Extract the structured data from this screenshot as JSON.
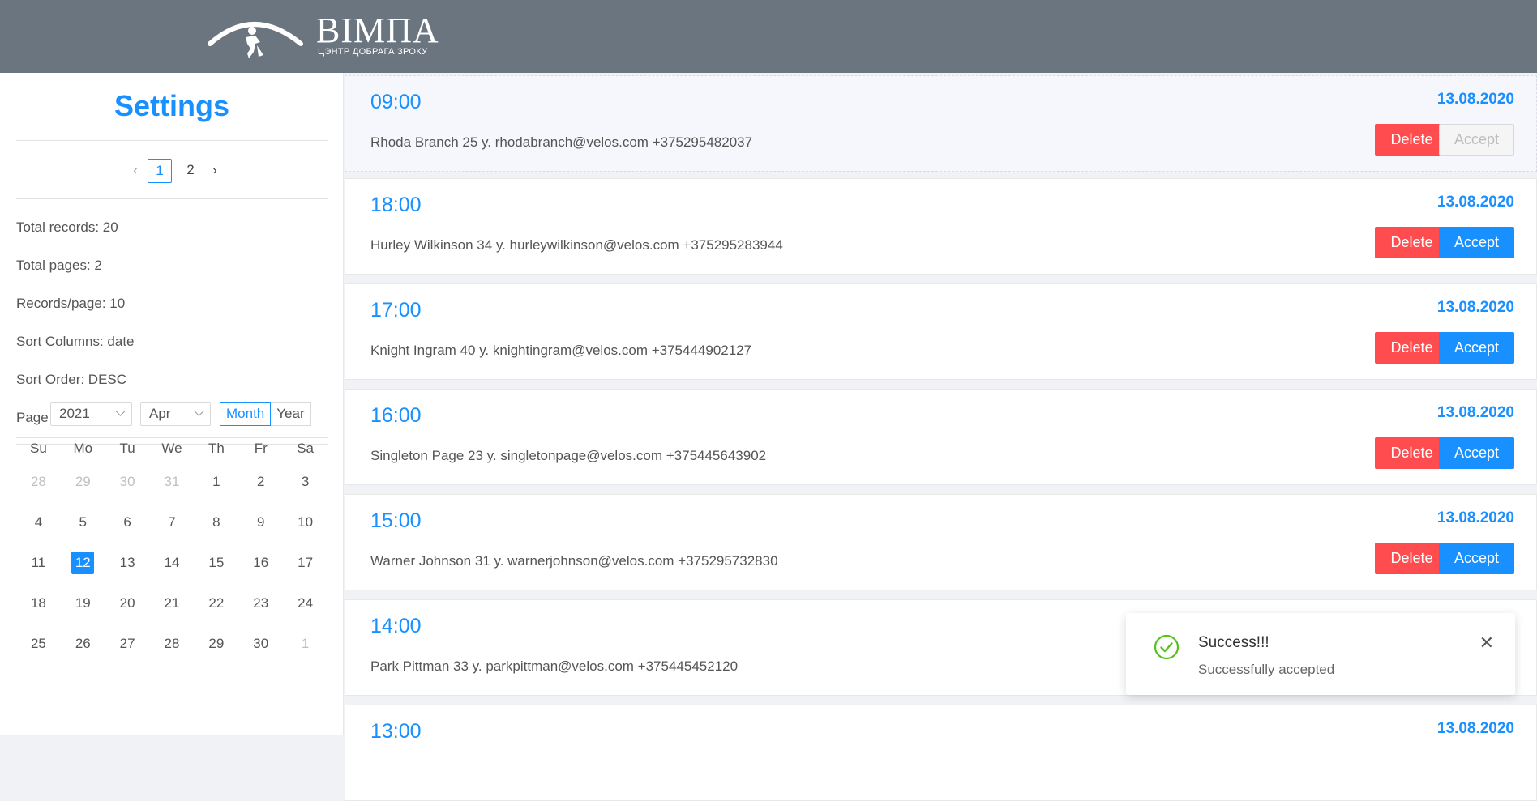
{
  "header": {
    "brand_name": "ВІМПА",
    "brand_subtitle": "ЦЭНТР ДОБРАГА ЗРОКУ",
    "background": "#6b7580"
  },
  "sidebar": {
    "title": "Settings",
    "pagination": {
      "prev_icon": "chevron-left-icon",
      "pages": [
        "1",
        "2"
      ],
      "current": "1",
      "next_icon": "chevron-right-icon"
    },
    "info": [
      "Total records: 20",
      "Total pages: 2",
      "Records/page: 10",
      "Sort Columns: date",
      "Sort Order: DESC",
      "Page index: 1"
    ],
    "calendar": {
      "year": "2021",
      "month": "Apr",
      "mode_month": "Month",
      "mode_year": "Year",
      "weekdays": [
        "Su",
        "Mo",
        "Tu",
        "We",
        "Th",
        "Fr",
        "Sa"
      ],
      "weeks": [
        [
          "28",
          "29",
          "30",
          "31",
          "1",
          "2",
          "3"
        ],
        [
          "4",
          "5",
          "6",
          "7",
          "8",
          "9",
          "10"
        ],
        [
          "11",
          "12",
          "13",
          "14",
          "15",
          "16",
          "17"
        ],
        [
          "18",
          "19",
          "20",
          "21",
          "22",
          "23",
          "24"
        ],
        [
          "25",
          "26",
          "27",
          "28",
          "29",
          "30",
          "1"
        ]
      ],
      "selected_day": "12"
    }
  },
  "records": [
    {
      "time": "09:00",
      "date": "13.08.2020",
      "details": "Rhoda Branch 25 y. rhodabranch@velos.com +375295482037",
      "delete_label": "Delete",
      "accept_label": "Accept",
      "accepted": true
    },
    {
      "time": "18:00",
      "date": "13.08.2020",
      "details": "Hurley Wilkinson 34 y. hurleywilkinson@velos.com +375295283944",
      "delete_label": "Delete",
      "accept_label": "Accept",
      "accepted": false
    },
    {
      "time": "17:00",
      "date": "13.08.2020",
      "details": "Knight Ingram 40 y. knightingram@velos.com +375444902127",
      "delete_label": "Delete",
      "accept_label": "Accept",
      "accepted": false
    },
    {
      "time": "16:00",
      "date": "13.08.2020",
      "details": "Singleton Page 23 y. singletonpage@velos.com +375445643902",
      "delete_label": "Delete",
      "accept_label": "Accept",
      "accepted": false
    },
    {
      "time": "15:00",
      "date": "13.08.2020",
      "details": "Warner Johnson 31 y. warnerjohnson@velos.com +375295732830",
      "delete_label": "Delete",
      "accept_label": "Accept",
      "accepted": false
    },
    {
      "time": "14:00",
      "date": "",
      "details": "Park Pittman 33 y. parkpittman@velos.com +375445452120",
      "delete_label": "",
      "accept_label": "",
      "accepted": false
    },
    {
      "time": "13:00",
      "date": "13.08.2020",
      "details": "",
      "delete_label": "",
      "accept_label": "",
      "accepted": false
    }
  ],
  "toast": {
    "icon": "check-circle-icon",
    "title": "Success!!!",
    "message": "Successfully accepted",
    "close_icon": "close-icon"
  },
  "colors": {
    "primary": "#1890ff",
    "danger": "#ff4d4f",
    "success": "#52c41a"
  }
}
